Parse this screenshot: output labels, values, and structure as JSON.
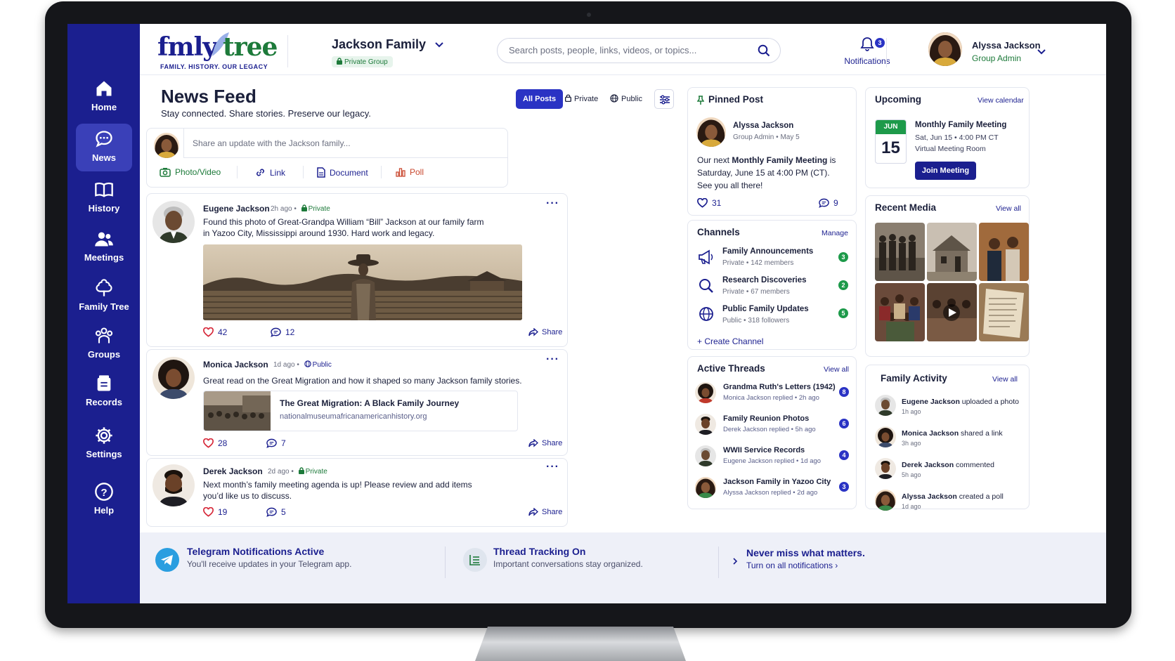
{
  "app": {
    "logo_fmly": "fmly",
    "logo_tree": "tree",
    "logo_tagline": "FAMILY. HISTORY. OUR LEGACY"
  },
  "sidebar": {
    "items": [
      {
        "label": "Home",
        "icon": "home-icon"
      },
      {
        "label": "News",
        "icon": "chat-bubble-icon",
        "active": true
      },
      {
        "label": "History",
        "icon": "book-icon"
      },
      {
        "label": "Meetings",
        "icon": "people-icon"
      },
      {
        "label": "Family Tree",
        "icon": "tree-icon"
      },
      {
        "label": "Groups",
        "icon": "group-icon"
      },
      {
        "label": "Records",
        "icon": "records-icon"
      },
      {
        "label": "Settings",
        "icon": "gear-icon"
      },
      {
        "label": "Help",
        "icon": "help-icon"
      }
    ]
  },
  "header": {
    "group_name": "Jackson Family",
    "group_type": "Private Group",
    "search_placeholder": "Search posts, people, links, videos, or topics...",
    "notif_count": "3",
    "notif_label": "Notifications",
    "user_name": "Alyssa Jackson",
    "user_role": "Group Admin"
  },
  "feed": {
    "title": "News Feed",
    "subtitle": "Stay connected. Share stories. Preserve our legacy.",
    "filters": {
      "all": "All Posts",
      "private": "Private",
      "public": "Public"
    },
    "composer": {
      "placeholder": "Share an update with the Jackson family...",
      "photo": "Photo/Video",
      "link": "Link",
      "document": "Document",
      "poll": "Poll"
    },
    "posts": [
      {
        "author": "Eugene Jackson",
        "time": "2h ago",
        "visibility": "Private",
        "text1": "Found this photo of Great-Grandpa William “Bill” Jackson at our family farm",
        "text2": "in Yazoo City, Mississippi around 1930. Hard work and legacy.",
        "likes": "42",
        "comments": "12",
        "share": "Share"
      },
      {
        "author": "Monica Jackson",
        "time": "1d ago",
        "visibility": "Public",
        "text1": "Great read on the Great Migration and how it shaped so many Jackson family stories.",
        "link_title": "The Great Migration: A Black Family Journey",
        "link_url": "nationalmuseumafricanamericanhistory.org",
        "likes": "28",
        "comments": "7",
        "share": "Share"
      },
      {
        "author": "Derek Jackson",
        "time": "2d ago",
        "visibility": "Private",
        "text1": "Next month’s family meeting agenda is up! Please review and add items",
        "text2": "you’d like us to discuss.",
        "likes": "19",
        "comments": "5",
        "share": "Share"
      }
    ]
  },
  "pinned": {
    "title": "Pinned Post",
    "author": "Alyssa Jackson",
    "role": "Group Admin",
    "date": "May 5",
    "text_a": "Our next ",
    "text_b": "Monthly Family Meeting",
    "text_c": " is",
    "text2": "Saturday, June 15 at 4:00 PM (CT).",
    "text3": "See you all there!",
    "likes": "31",
    "comments": "9"
  },
  "channels": {
    "title": "Channels",
    "manage": "Manage",
    "items": [
      {
        "name": "Family Announcements",
        "type": "Private",
        "count": "142 members",
        "badge": "3"
      },
      {
        "name": "Research Discoveries",
        "type": "Private",
        "count": "67 members",
        "badge": "2"
      },
      {
        "name": "Public Family Updates",
        "type": "Public",
        "count": "318 followers",
        "badge": "5"
      }
    ],
    "create": "+ Create Channel"
  },
  "threads": {
    "title": "Active Threads",
    "view_all": "View all",
    "items": [
      {
        "name": "Grandma Ruth's Letters (1942)",
        "by": "Monica Jackson replied",
        "time": "2h ago",
        "badge": "8"
      },
      {
        "name": "Family Reunion Photos",
        "by": "Derek Jackson replied",
        "time": "5h ago",
        "badge": "6"
      },
      {
        "name": "WWII Service Records",
        "by": "Eugene Jackson replied",
        "time": "1d ago",
        "badge": "4"
      },
      {
        "name": "Jackson Family in Yazoo City",
        "by": "Alyssa Jackson replied",
        "time": "2d ago",
        "badge": "3"
      }
    ]
  },
  "upcoming": {
    "title": "Upcoming",
    "view_calendar": "View calendar",
    "month": "JUN",
    "day": "15",
    "event": "Monthly Family Meeting",
    "when": "Sat, Jun 15  •  4:00 PM CT",
    "where": "Virtual Meeting Room",
    "join": "Join Meeting"
  },
  "media": {
    "title": "Recent Media",
    "view_all": "View all"
  },
  "activity": {
    "title": "Family Activity",
    "view_all": "View all",
    "items": [
      {
        "name": "Eugene Jackson",
        "action": " uploaded a photo",
        "time": "1h ago"
      },
      {
        "name": "Monica Jackson",
        "action": " shared a link",
        "time": "3h ago"
      },
      {
        "name": "Derek Jackson",
        "action": " commented",
        "time": "5h ago"
      },
      {
        "name": "Alyssa Jackson",
        "action": " created a poll",
        "time": "1d ago"
      }
    ]
  },
  "footer": {
    "telegram_title": "Telegram Notifications Active",
    "telegram_sub": "You'll receive updates in your Telegram app.",
    "thread_title": "Thread Tracking On",
    "thread_sub": "Important conversations stay organized.",
    "never_title": "Never miss what matters.",
    "never_sub": "Turn on all notifications  ›"
  },
  "colors": {
    "brand": "#1b1f8f",
    "accent_green": "#1d7a3a",
    "like_red": "#d62839"
  }
}
